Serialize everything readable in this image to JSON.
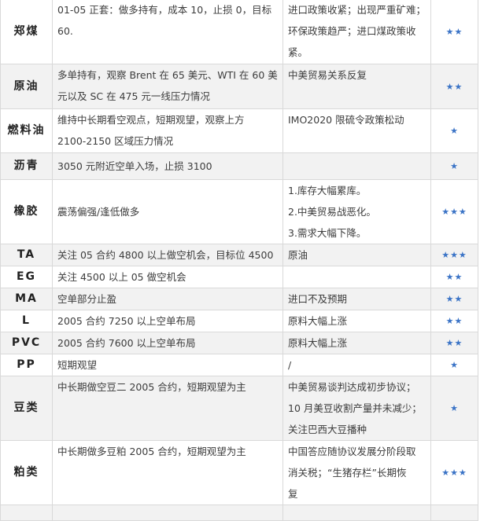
{
  "rows": [
    {
      "name": "郑煤",
      "strategy": [
        "01-05 正套：做多持有，成本 10，止损 0，目标",
        "60."
      ],
      "risk": [
        "进口政策收紧；出现严重矿难；",
        "环保政策趋严；进口煤政策收",
        "紧。"
      ],
      "rating": "★★"
    },
    {
      "name": "原油",
      "strategy": [
        "多单持有，观察 Brent 在 65 美元、WTI 在 60 美",
        "元以及 SC 在 475 元一线压力情况"
      ],
      "risk": [
        "中美贸易关系反复"
      ],
      "rating": "★★"
    },
    {
      "name": "燃料油",
      "strategy": [
        "维持中长期看空观点，短期观望，观察上方",
        "2100-2150 区域压力情况"
      ],
      "risk": [
        "IMO2020 限硫令政策松动"
      ],
      "rating": "★"
    },
    {
      "name": "沥青",
      "strategy": [
        "3050 元附近空单入场，止损 3100"
      ],
      "risk": [],
      "rating": "★"
    },
    {
      "name": "橡胶",
      "strategy": [
        "震荡偏强/逢低做多"
      ],
      "risk": [
        "1.库存大幅累库。",
        "2.中美贸易战恶化。",
        "3.需求大幅下降。"
      ],
      "rating": "★★★"
    },
    {
      "name": "TA",
      "strategy": [
        "关注 05 合约 4800 以上做空机会，目标位 4500"
      ],
      "risk": [
        "原油"
      ],
      "rating": "★★★"
    },
    {
      "name": "EG",
      "strategy": [
        "关注 4500 以上 05 做空机会"
      ],
      "risk": [],
      "rating": "★★"
    },
    {
      "name": "MA",
      "strategy": [
        "空单部分止盈"
      ],
      "risk": [
        "进口不及预期"
      ],
      "rating": "★★"
    },
    {
      "name": "L",
      "strategy": [
        "2005 合约 7250 以上空单布局"
      ],
      "risk": [
        "原料大幅上涨"
      ],
      "rating": "★★"
    },
    {
      "name": "PVC",
      "strategy": [
        "2005 合约 7600 以上空单布局"
      ],
      "risk": [
        "原料大幅上涨"
      ],
      "rating": "★★"
    },
    {
      "name": "PP",
      "strategy": [
        "短期观望"
      ],
      "risk": [
        "/"
      ],
      "rating": "★"
    },
    {
      "name": "豆类",
      "strategy": [
        "中长期做空豆二 2005 合约，短期观望为主"
      ],
      "risk": [
        "中美贸易谈判达成初步协议；",
        "10 月美豆收割产量并未减少；",
        "关注巴西大豆播种"
      ],
      "rating": "★"
    },
    {
      "name": "粕类",
      "strategy": [
        "中长期做多豆粕 2005 合约，短期观望为主"
      ],
      "risk": [
        "中国答应随协议发展分阶段取",
        "消关税；“生猪存栏”长期恢",
        "复"
      ],
      "rating": "★★★"
    }
  ]
}
